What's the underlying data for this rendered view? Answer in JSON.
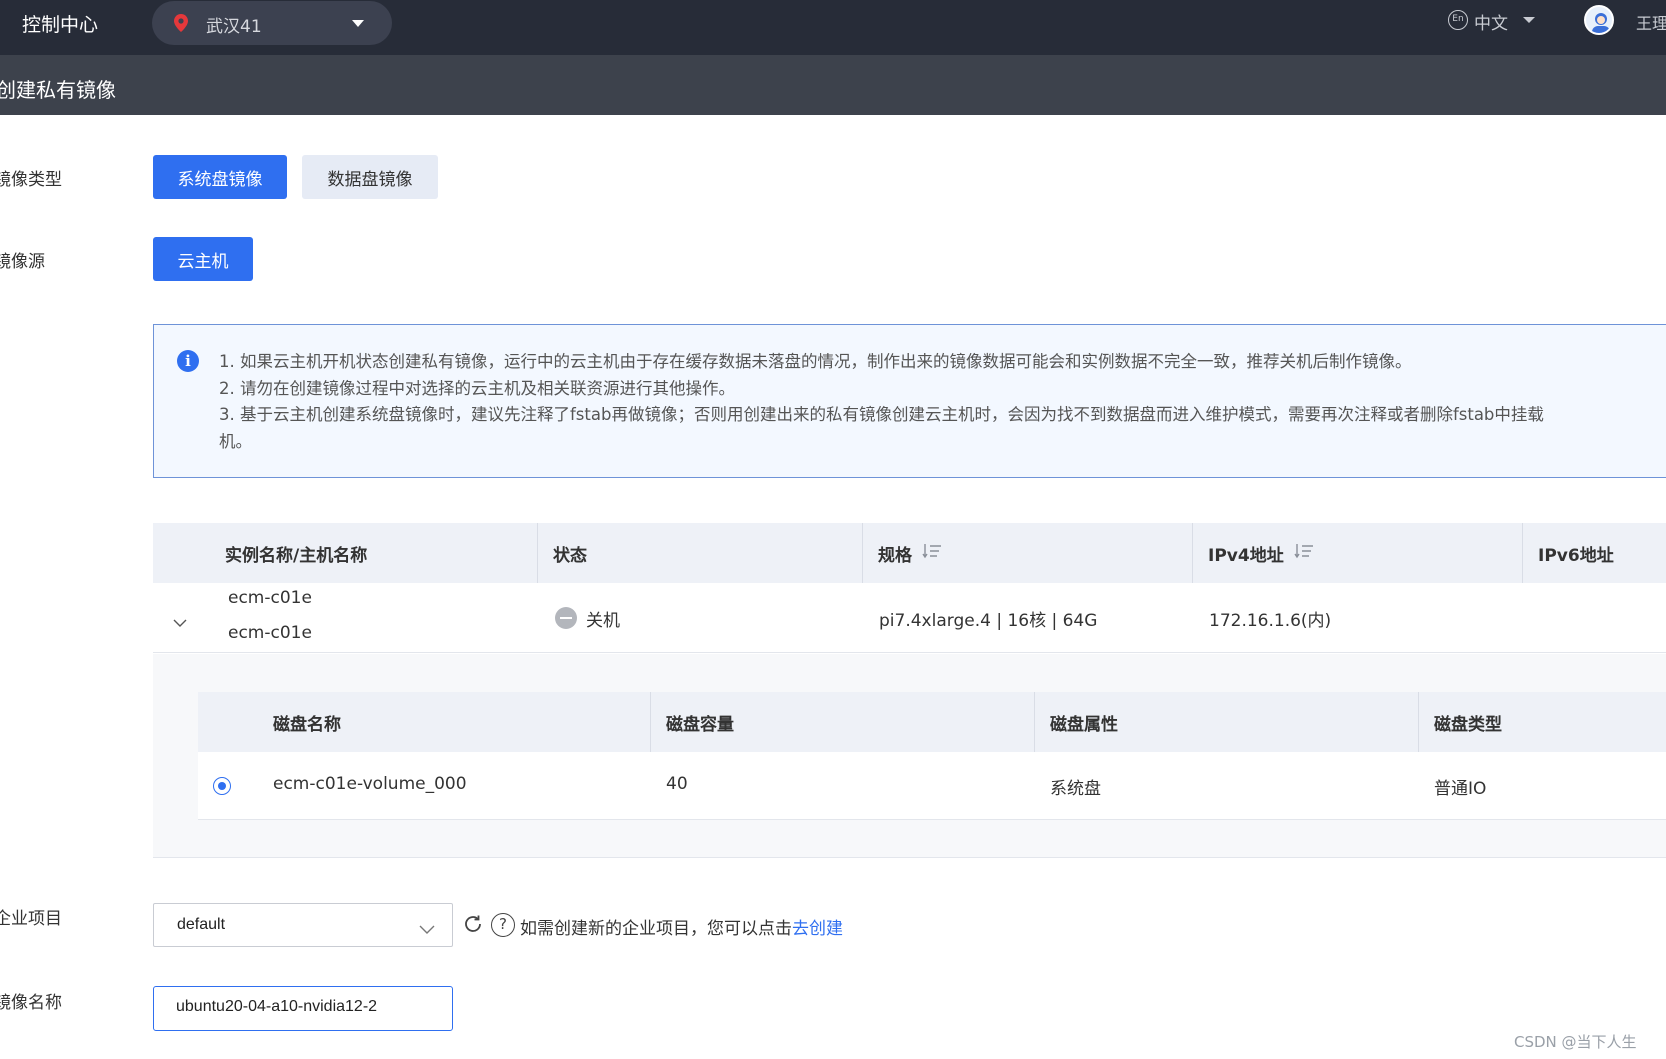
{
  "header": {
    "brand": "控制中心",
    "region": "武汉41",
    "language_icon": "En",
    "language": "中文",
    "user": "王理"
  },
  "page": {
    "title": "创建私有镜像"
  },
  "form": {
    "image_type": {
      "label": "镜像类型",
      "options": [
        {
          "label": "系统盘镜像",
          "selected": true
        },
        {
          "label": "数据盘镜像",
          "selected": false
        }
      ]
    },
    "image_source": {
      "label": "镜像源",
      "options": [
        {
          "label": "云主机",
          "selected": true
        }
      ]
    },
    "notice": {
      "lines": [
        "1. 如果云主机开机状态创建私有镜像，运行中的云主机由于存在缓存数据未落盘的情况，制作出来的镜像数据可能会和实例数据不完全一致，推荐关机后制作镜像。",
        "2. 请勿在创建镜像过程中对选择的云主机及相关联资源进行其他操作。",
        "3. 基于云主机创建系统盘镜像时，建议先注释了fstab再做镜像；否则用创建出来的私有镜像创建云主机时，会因为找不到数据盘而进入维护模式，需要再次注释或者删除fstab中挂载",
        "机。"
      ]
    },
    "enterprise_project": {
      "label": "企业项目",
      "value": "default",
      "hint_prefix": "如需创建新的企业项目，您可以点击",
      "hint_link": "去创建"
    },
    "image_name": {
      "label": "镜像名称",
      "value": "ubuntu20-04-a10-nvidia12-2"
    }
  },
  "instance_table": {
    "columns": {
      "name": "实例名称/主机名称",
      "status": "状态",
      "spec": "规格",
      "ipv4": "IPv4地址",
      "ipv6": "IPv6地址"
    },
    "rows": [
      {
        "instance_name": "ecm-c01e",
        "host_name": "ecm-c01e",
        "status": "关机",
        "spec": "pi7.4xlarge.4 | 16核 | 64G",
        "ipv4": "172.16.1.6(内)"
      }
    ]
  },
  "disk_table": {
    "columns": {
      "name": "磁盘名称",
      "capacity": "磁盘容量",
      "attribute": "磁盘属性",
      "type": "磁盘类型"
    },
    "rows": [
      {
        "name": "ecm-c01e-volume_000",
        "capacity": "40",
        "attribute": "系统盘",
        "type": "普通IO",
        "selected": true
      }
    ]
  },
  "watermark": "CSDN @当下人生",
  "colors": {
    "primary": "#2f6ff0",
    "topbar": "#272c38",
    "titlebar": "#3d424c",
    "region_pin": "#e5383b"
  }
}
